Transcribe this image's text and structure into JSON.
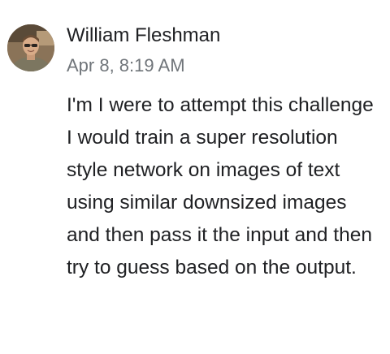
{
  "comment": {
    "author": "William Fleshman",
    "timestamp": "Apr 8, 8:19 AM",
    "text": "I'm I were to attempt this challenge I would train a super resolution style network on images of text using similar downsized images and then pass it the input and then try to guess based on the output.",
    "avatar_icon": "user-avatar-photo"
  },
  "colors": {
    "text_primary": "#202124",
    "text_secondary": "#70757a"
  }
}
